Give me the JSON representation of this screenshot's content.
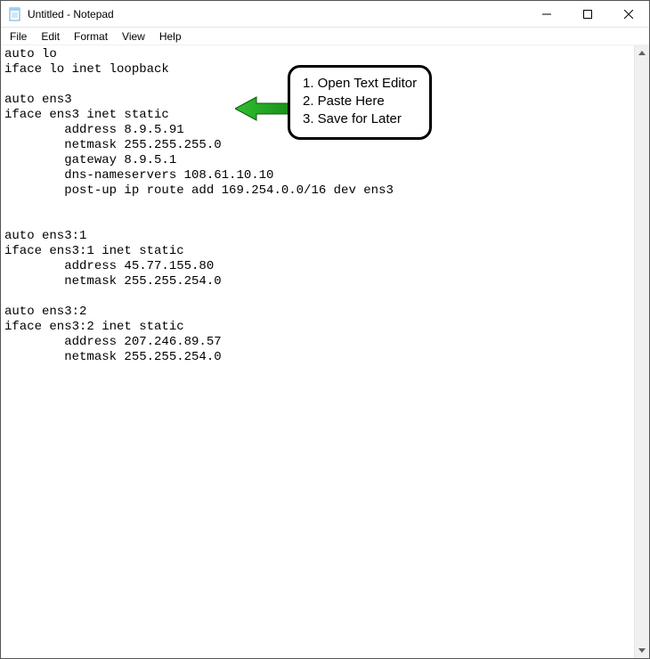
{
  "window": {
    "title": "Untitled - Notepad"
  },
  "menubar": {
    "file": "File",
    "edit": "Edit",
    "format": "Format",
    "view": "View",
    "help": "Help"
  },
  "editor": {
    "content": "auto lo\niface lo inet loopback\n\nauto ens3\niface ens3 inet static\n        address 8.9.5.91\n        netmask 255.255.255.0\n        gateway 8.9.5.1\n        dns-nameservers 108.61.10.10\n        post-up ip route add 169.254.0.0/16 dev ens3\n\n\nauto ens3:1\niface ens3:1 inet static\n        address 45.77.155.80\n        netmask 255.255.254.0\n\nauto ens3:2\niface ens3:2 inet static\n        address 207.246.89.57\n        netmask 255.255.254.0"
  },
  "callout": {
    "line1": "1. Open Text Editor",
    "line2": "2. Paste Here",
    "line3": "3. Save for Later"
  }
}
